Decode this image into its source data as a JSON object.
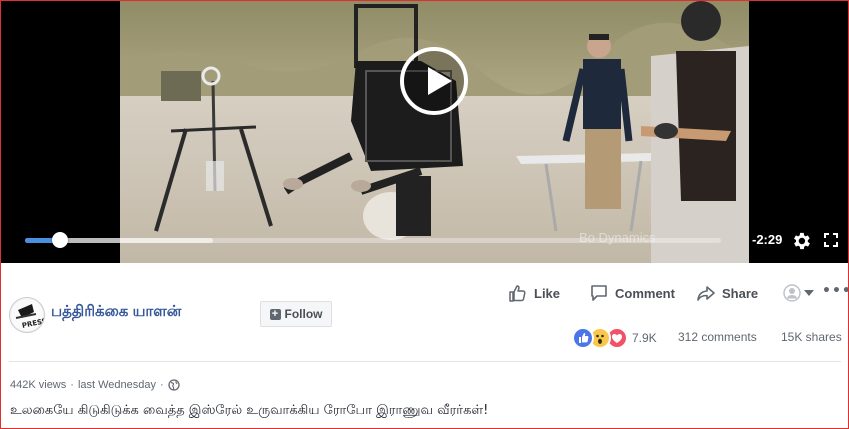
{
  "video": {
    "time_remaining": "-2:29",
    "watermark_text": "Bo   Dynamics",
    "progress_played": 0.05,
    "progress_buffered": 0.27
  },
  "actions": {
    "like_label": "Like",
    "comment_label": "Comment",
    "share_label": "Share"
  },
  "page": {
    "name": "பத்திரிக்கை யாளன்",
    "avatar_text": "PRESS",
    "follow_label": "Follow"
  },
  "stats": {
    "reactions_count": "7.9K",
    "comments": "312 comments",
    "shares": "15K shares"
  },
  "meta": {
    "views": "442K views",
    "separator": "·",
    "posted": "last Wednesday"
  },
  "caption": "உலகையே கிடுகிடுக்க வைத்த இஸ்ரேல் உருவாக்கிய ரோபோ இராணுவ வீரர்கள்!",
  "colors": {
    "frame_border": "#e02f2f",
    "link_blue": "#365899",
    "progress_blue": "#4a90e2",
    "text_gray": "#606770"
  }
}
